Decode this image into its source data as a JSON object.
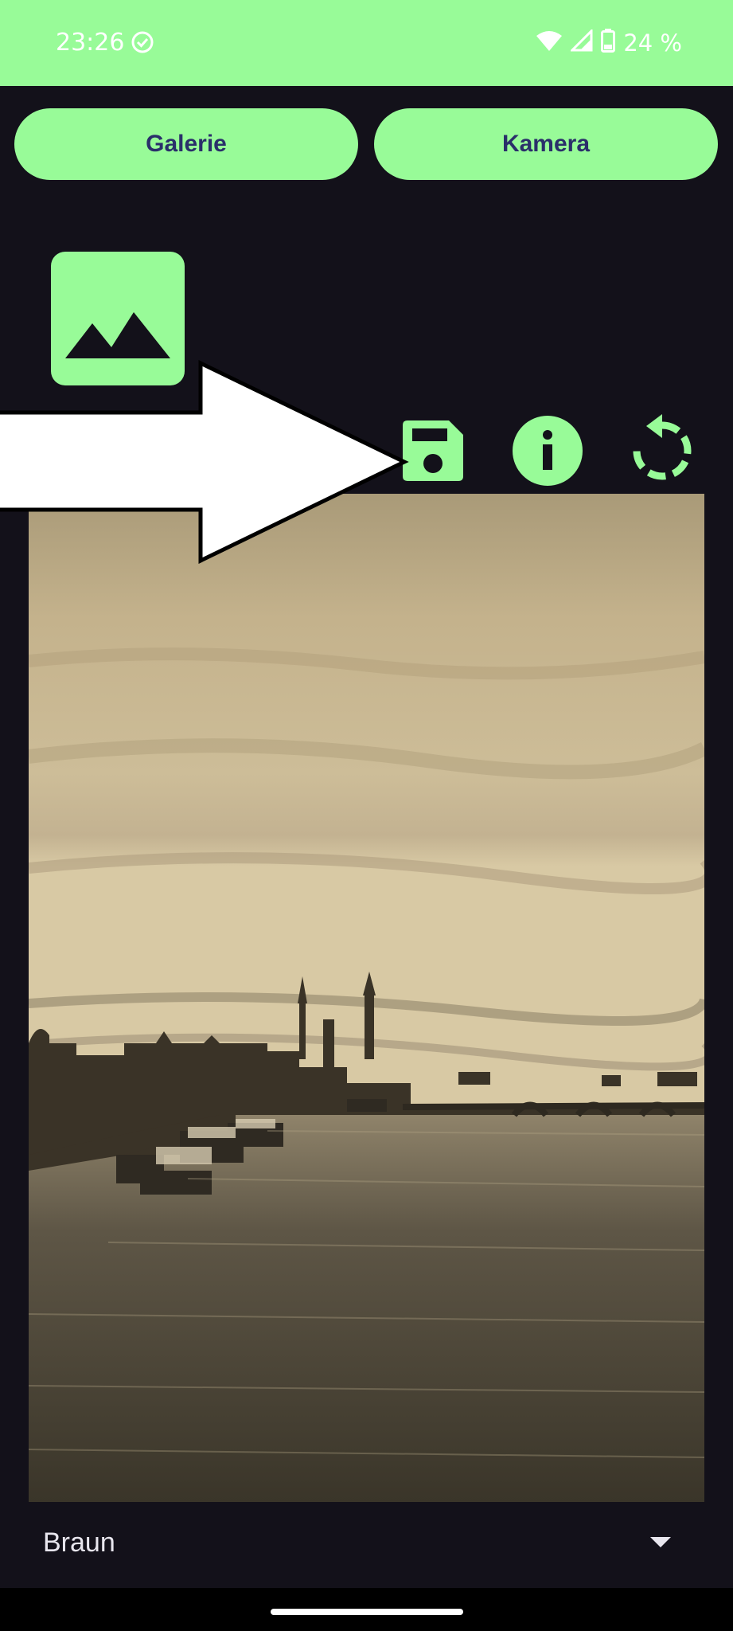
{
  "status_bar": {
    "time": "23:26",
    "battery": "24 %",
    "icons": [
      "check-circle-icon",
      "wifi-icon",
      "signal-icon",
      "battery-icon"
    ]
  },
  "buttons": {
    "galerie": "Galerie",
    "kamera": "Kamera"
  },
  "toolbar": {
    "icons": [
      "save-icon",
      "info-icon",
      "rotate-icon"
    ]
  },
  "filter": {
    "selected": "Braun"
  },
  "colors": {
    "accent": "#98fb98",
    "background": "#13111a",
    "button_text": "#2a2f6a"
  }
}
